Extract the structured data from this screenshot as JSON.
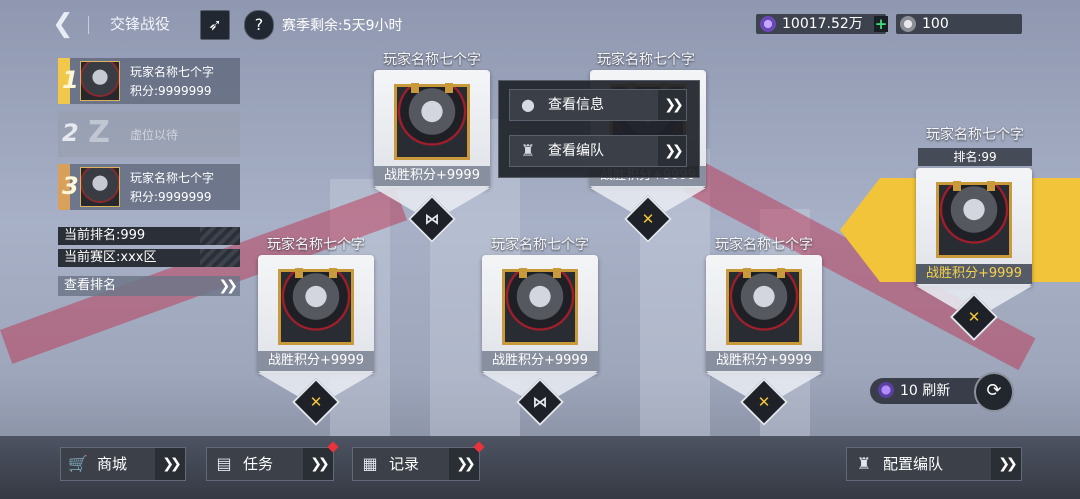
{
  "header": {
    "back_icon": "back-chevron-icon",
    "title": "交锋战役",
    "season_label": "赛季剩余:5天9小时",
    "currency1": {
      "icon": "purple-gem-icon",
      "value": "10017.52万",
      "plus": "+"
    },
    "currency2": {
      "icon": "silver-coin-icon",
      "value": "100"
    }
  },
  "leaderboard": {
    "items": [
      {
        "rank": "1",
        "name": "玩家名称七个字",
        "score": "积分:9999999"
      },
      {
        "rank": "2",
        "placeholder": "虚位以待"
      },
      {
        "rank": "3",
        "name": "玩家名称七个字",
        "score": "积分:9999999"
      }
    ],
    "current_rank": "当前排名:999",
    "current_zone": "当前赛区:xxx区",
    "view_rank": "查看排名",
    "chevrons": "»"
  },
  "opponents": [
    {
      "name": "玩家名称七个字",
      "score": "战胜积分+9999",
      "badge": "stripe"
    },
    {
      "name": "玩家名称七个字",
      "score": "战胜积分+9999",
      "badge": "swords"
    },
    {
      "name": "玩家名称七个字",
      "score": "战胜积分+9999",
      "badge": "swords"
    },
    {
      "name": "玩家名称七个字",
      "score": "战胜积分+9999",
      "badge": "stripe"
    },
    {
      "name": "玩家名称七个字",
      "score": "战胜积分+9999",
      "badge": "swords"
    }
  ],
  "selected_opponent": {
    "name": "玩家名称七个字",
    "rank": "排名:99",
    "score": "战胜积分+9999"
  },
  "popup": {
    "view_info": "查看信息",
    "view_team": "查看编队"
  },
  "refresh": {
    "cost": "10 刷新"
  },
  "bottom": {
    "shop": "商城",
    "tasks": "任务",
    "records": "记录",
    "configure_team": "配置编队"
  },
  "colors": {
    "accent": "#f2c43a",
    "alert": "#e8323c",
    "frame_gold": "#c99a3c"
  }
}
